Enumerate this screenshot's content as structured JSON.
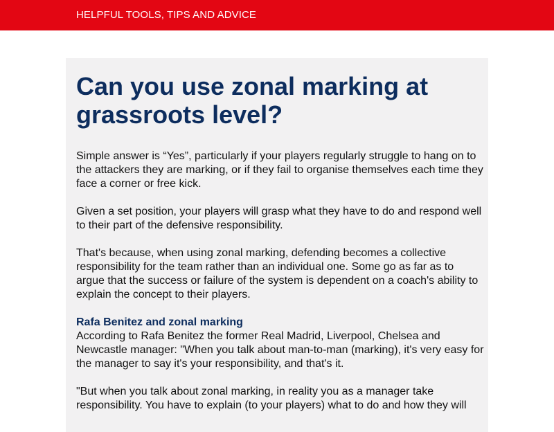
{
  "header": {
    "tagline": "HELPFUL TOOLS, TIPS AND ADVICE"
  },
  "article": {
    "title": "Can you use zonal marking at grassroots level?",
    "paragraphs": [
      "Simple answer is “Yes”, particularly if your players regularly struggle to hang on to the attackers they are marking, or if they fail to organise themselves each time they face a corner or free kick.",
      "Given a set position, your players will grasp what they have to do and respond well to their part of the defensive responsibility.",
      "That's because, when using zonal marking, defending becomes a collective responsibility for the team rather than an individual one. Some go as far as to argue that the success or failure of the system is dependent on a coach's ability to explain the concept to their players."
    ],
    "section": {
      "heading": "Rafa Benitez and zonal marking",
      "body": "According to Rafa Benitez the former Real Madrid, Liverpool, Chelsea and Newcastle manager: \"When you talk about man-to-man (marking), it's very easy for the manager to say it's your responsibility, and that's it."
    },
    "quote_continued": "\"But when you talk about zonal marking, in reality you as a manager take responsibility. You have to explain (to your players) what to do and how they will"
  },
  "colors": {
    "header_bg": "#e30613",
    "title": "#0d2d5e",
    "card_bg": "#f2f1f2"
  }
}
